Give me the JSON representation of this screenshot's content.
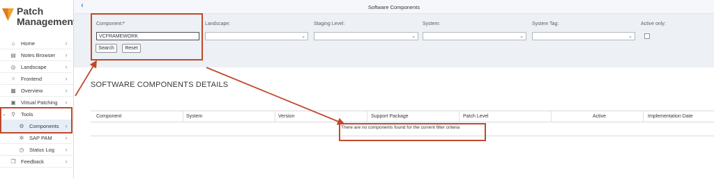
{
  "app": {
    "brand_line1": "Patch",
    "brand_line2": "Management"
  },
  "sidebar": {
    "items": [
      {
        "label": "Home",
        "icon": "home-icon"
      },
      {
        "label": "Notes Browser",
        "icon": "notes-icon"
      },
      {
        "label": "Landscape",
        "icon": "globe-icon"
      },
      {
        "label": "Frontend",
        "icon": "branch-icon"
      },
      {
        "label": "Overview",
        "icon": "grid-icon"
      },
      {
        "label": "Virtual Patching",
        "icon": "document-icon"
      },
      {
        "label": "Tools",
        "icon": "wrench-icon"
      },
      {
        "label": "Components",
        "icon": "gear-icon"
      },
      {
        "label": "SAP PAM",
        "icon": "settings-icon"
      },
      {
        "label": "Status Log",
        "icon": "clock-icon"
      },
      {
        "label": "Feedback",
        "icon": "chat-icon"
      }
    ]
  },
  "header": {
    "title": "Software Components"
  },
  "filters": {
    "component_label": "Component:",
    "required_mark": "*",
    "component_value": "VCFRAMEWORK",
    "landscape_label": "Landscape:",
    "staging_label": "Staging Level:",
    "system_label": "System:",
    "systemtag_label": "System Tag:",
    "active_label": "Active only:",
    "search_label": "Search",
    "reset_label": "Reset"
  },
  "details": {
    "title": "SOFTWARE COMPONENTS DETAILS",
    "columns": [
      "Component",
      "System",
      "Version",
      "Support Package",
      "Patch Level",
      "Active",
      "Implementation Date"
    ],
    "empty_message": "There are no components found for the current filter criteria"
  },
  "colors": {
    "annotation": "#c0482b",
    "accent": "#1a5fa0",
    "filter_bg": "#edf0f4"
  }
}
